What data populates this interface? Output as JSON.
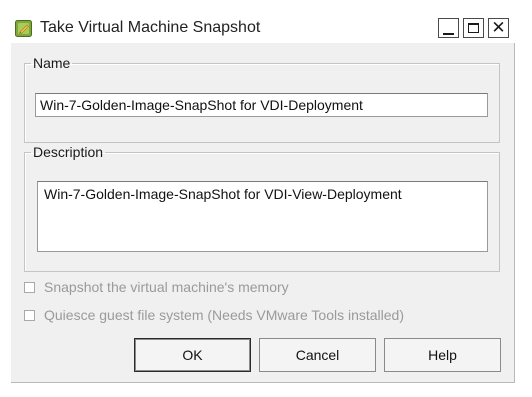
{
  "window": {
    "title": "Take Virtual Machine Snapshot",
    "icon": "vm-snapshot-icon",
    "controls": [
      "minimize-icon",
      "maximize-icon",
      "close-icon"
    ]
  },
  "name_group": {
    "legend": "Name",
    "value": "Win-7-Golden-Image-SnapShot for VDI-Deployment"
  },
  "description_group": {
    "legend": "Description",
    "value": "Win-7-Golden-Image-SnapShot for VDI-View-Deployment"
  },
  "options": {
    "memory": {
      "label": "Snapshot the virtual machine's memory",
      "checked": false,
      "enabled": false
    },
    "quiesce": {
      "label": "Quiesce guest file system (Needs VMware Tools installed)",
      "checked": false,
      "enabled": false
    }
  },
  "buttons": {
    "ok": "OK",
    "cancel": "Cancel",
    "help": "Help"
  },
  "colors": {
    "dialog_background": "#f0f0f0",
    "disabled_text": "#9a9a9a",
    "icon_green": "#6a9a2a",
    "icon_orange": "#e8a030"
  }
}
